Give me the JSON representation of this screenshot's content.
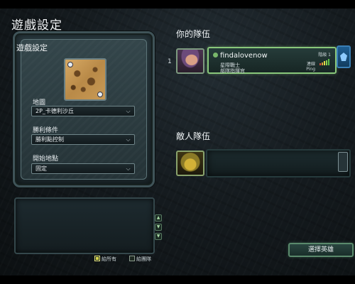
{
  "header": {
    "title": "遊戲設定"
  },
  "settings": {
    "panel_title": "遊戲設定",
    "map": {
      "label": "地圖",
      "value": "2P_卡德利沙丘"
    },
    "victory": {
      "label": "勝利條件",
      "value": "勝利點控制"
    },
    "start": {
      "label": "開始地點",
      "value": "固定"
    }
  },
  "chat": {
    "filters": [
      {
        "label": "給所有",
        "checked": true
      },
      {
        "label": "給團隊",
        "checked": false
      }
    ],
    "buttons": [
      "▲",
      "▼",
      "▼"
    ]
  },
  "ally_team": {
    "title": "你的隊伍",
    "slot_number": "1",
    "player": {
      "name": "findalovenow",
      "race": "星際戰士",
      "role": "部隊指揮官",
      "level_label": "階級 1",
      "connection_label": "連線",
      "ping_label": "Ping",
      "signal_colors": [
        "#d94a3c",
        "#e2a23a",
        "#e6d84a",
        "#8fd14f",
        "#5ec24a"
      ]
    }
  },
  "enemy_team": {
    "title": "敵人隊伍"
  },
  "actions": {
    "select_hero": "選擇英雄"
  },
  "colors": {
    "ally_accent": "#89c77b",
    "team_blue": "#3a7fb5"
  }
}
